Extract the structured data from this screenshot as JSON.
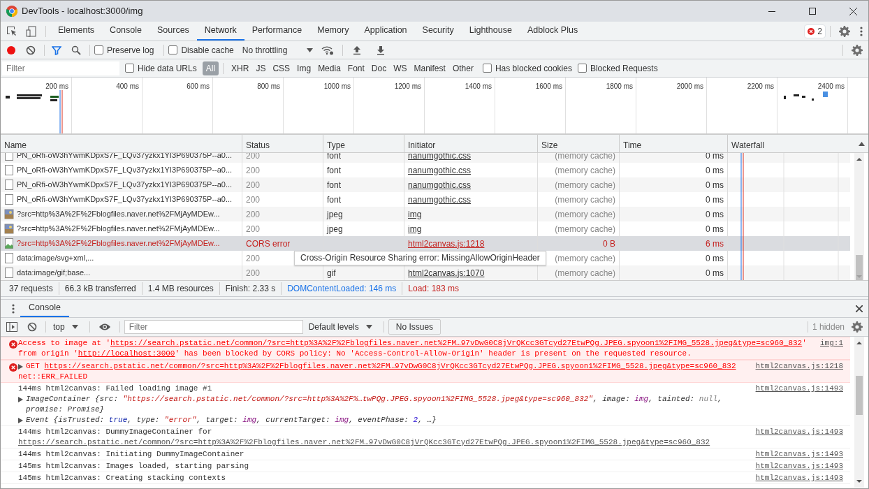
{
  "window": {
    "title": "DevTools - localhost:3000/img"
  },
  "panel_tabs": [
    {
      "label": "Elements",
      "selected": false
    },
    {
      "label": "Console",
      "selected": false
    },
    {
      "label": "Sources",
      "selected": false
    },
    {
      "label": "Network",
      "selected": true
    },
    {
      "label": "Performance",
      "selected": false
    },
    {
      "label": "Memory",
      "selected": false
    },
    {
      "label": "Application",
      "selected": false
    },
    {
      "label": "Security",
      "selected": false
    },
    {
      "label": "Lighthouse",
      "selected": false
    },
    {
      "label": "Adblock Plus",
      "selected": false
    }
  ],
  "error_count": "2",
  "network_toolbar": {
    "recording": true,
    "preserve_log": {
      "label": "Preserve log",
      "checked": false
    },
    "disable_cache": {
      "label": "Disable cache",
      "checked": false
    },
    "throttling": "No throttling"
  },
  "filter_bar": {
    "placeholder": "Filter",
    "hide_data_urls": {
      "label": "Hide data URLs",
      "checked": false
    },
    "types": [
      {
        "label": "All",
        "selected": true
      },
      {
        "label": "XHR",
        "selected": false
      },
      {
        "label": "JS",
        "selected": false
      },
      {
        "label": "CSS",
        "selected": false
      },
      {
        "label": "Img",
        "selected": false
      },
      {
        "label": "Media",
        "selected": false
      },
      {
        "label": "Font",
        "selected": false
      },
      {
        "label": "Doc",
        "selected": false
      },
      {
        "label": "WS",
        "selected": false
      },
      {
        "label": "Manifest",
        "selected": false
      },
      {
        "label": "Other",
        "selected": false
      }
    ],
    "extra_checks": [
      {
        "label": "Has blocked cookies",
        "checked": false
      },
      {
        "label": "Blocked Requests",
        "checked": false
      }
    ]
  },
  "overview": {
    "ticks": [
      "200 ms",
      "400 ms",
      "600 ms",
      "800 ms",
      "1000 ms",
      "1200 ms",
      "1400 ms",
      "1600 ms",
      "1800 ms",
      "2000 ms",
      "2200 ms",
      "2400 ms"
    ]
  },
  "table": {
    "columns": [
      "Name",
      "Status",
      "Type",
      "Initiator",
      "Size",
      "Time",
      "Waterfall"
    ],
    "rows": [
      {
        "kind": "file",
        "name": "PN_oRfi-oW3hYwmKDpxS7F_LQv37yzkx1YI3P690375P--a0...",
        "status": "200",
        "type": "font",
        "initiator": "nanumgothic.css",
        "size": "(memory cache)",
        "time": "0 ms",
        "error": false,
        "selected": false
      },
      {
        "kind": "file",
        "name": "PN_oRfi-oW3hYwmKDpxS7F_LQv37yzkx1YI3P690375P--a0...",
        "status": "200",
        "type": "font",
        "initiator": "nanumgothic.css",
        "size": "(memory cache)",
        "time": "0 ms",
        "error": false,
        "selected": false
      },
      {
        "kind": "file",
        "name": "PN_oRfi-oW3hYwmKDpxS7F_LQv37yzkx1YI3P690375P--a0...",
        "status": "200",
        "type": "font",
        "initiator": "nanumgothic.css",
        "size": "(memory cache)",
        "time": "0 ms",
        "error": false,
        "selected": false
      },
      {
        "kind": "file",
        "name": "PN_oRfi-oW3hYwmKDpxS7F_LQv37yzkx1YI3P690375P--a0...",
        "status": "200",
        "type": "font",
        "initiator": "nanumgothic.css",
        "size": "(memory cache)",
        "time": "0 ms",
        "error": false,
        "selected": false
      },
      {
        "kind": "image",
        "name": "?src=http%3A%2F%2Fblogfiles.naver.net%2FMjAyMDEw...",
        "status": "200",
        "type": "jpeg",
        "initiator": "img",
        "size": "(memory cache)",
        "time": "0 ms",
        "error": false,
        "selected": false
      },
      {
        "kind": "image",
        "name": "?src=http%3A%2F%2Fblogfiles.naver.net%2FMjAyMDEw...",
        "status": "200",
        "type": "jpeg",
        "initiator": "img",
        "size": "(memory cache)",
        "time": "0 ms",
        "error": false,
        "selected": false
      },
      {
        "kind": "broken-image",
        "name": "?src=http%3A%2F%2Fblogfiles.naver.net%2FMjAyMDEw...",
        "status": "CORS error",
        "initiator": "html2canvas.js:1218",
        "size": "0 B",
        "time": "6 ms",
        "error": true,
        "selected": true
      },
      {
        "kind": "file",
        "name": "data:image/svg+xml,...",
        "status": "200",
        "size": "(memory cache)",
        "time": "0 ms",
        "error": false,
        "selected": false
      },
      {
        "kind": "file",
        "name": "data:image/gif;base...",
        "status": "200",
        "type": "gif",
        "initiator": "html2canvas.js:1070",
        "size": "(memory cache)",
        "time": "0 ms",
        "error": false,
        "selected": false
      }
    ]
  },
  "tooltip": "Cross-Origin Resource Sharing error: MissingAllowOriginHeader",
  "summary": [
    {
      "kind": "plain",
      "text": "37 requests"
    },
    {
      "kind": "plain",
      "text": "66.3 kB transferred"
    },
    {
      "kind": "plain",
      "text": "1.4 MB resources"
    },
    {
      "kind": "plain",
      "text": "Finish: 2.33 s"
    },
    {
      "kind": "dom",
      "text": "DOMContentLoaded: 146 ms"
    },
    {
      "kind": "load",
      "text": "Load: 183 ms"
    }
  ],
  "drawer": {
    "tabs": [
      {
        "label": "Console",
        "selected": true
      }
    ],
    "context": "top",
    "filter_placeholder": "Filter",
    "levels": "Default levels",
    "issues": "No Issues",
    "hidden": "1 hidden"
  },
  "messages": [
    {
      "kind": "error",
      "expandable": false,
      "parts": [
        {
          "kind": "plain",
          "text": "Access to image at '"
        },
        {
          "kind": "link",
          "text": "https://search.pstatic.net/common/?src=http%3A%2F%2Fblogfiles.naver.net%2FM…97vDwG0C8jVrQKcc3GTcyd27EtwPQg.JPEG.spyoon1%2FIMG_5528.jpeg&type=sc960_832"
        },
        {
          "kind": "plain",
          "text": "' from origin '"
        },
        {
          "kind": "link",
          "text": "http://localhost:3000"
        },
        {
          "kind": "plain",
          "text": "' has been blocked by CORS policy: No 'Access-Control-Allow-Origin' header is present on the requested resource."
        }
      ],
      "source": "img:1"
    },
    {
      "kind": "error",
      "expandable": true,
      "parts": [
        {
          "kind": "plain",
          "text": "GET "
        },
        {
          "kind": "link",
          "text": "https://search.pstatic.net/common/?src=http%3A%2F%2Fblogfiles.naver.net%2FM…97vDwG0C8jVrQKcc3GTcyd27EtwPQg.JPEG.spyoon1%2FIMG_5528.jpeg&type=sc960_832"
        }
      ],
      "detail": "net::ERR_FAILED",
      "source": "html2canvas.js:1218"
    },
    {
      "kind": "log",
      "expandable": false,
      "parts": [
        {
          "kind": "plain",
          "text": "144ms html2canvas: Failed loading image #1"
        }
      ],
      "source": "html2canvas.js:1493",
      "objects": [
        [
          {
            "kind": "plain",
            "text": "ImageContainer {src: "
          },
          {
            "kind": "string",
            "text": "\"https://search.pstatic.net/common/?src=http%3A%2F%…twPQg.JPEG.spyoon1%2FIMG_5528.jpeg&type=sc960_832\""
          },
          {
            "kind": "plain",
            "text": ", image: "
          },
          {
            "kind": "node",
            "text": "img"
          },
          {
            "kind": "plain",
            "text": ", tainted: "
          },
          {
            "kind": "null",
            "text": "null"
          },
          {
            "kind": "plain",
            "text": ", promise: Promise}"
          }
        ],
        [
          {
            "kind": "plain",
            "text": "Event {isTrusted: "
          },
          {
            "kind": "keyword",
            "text": "true"
          },
          {
            "kind": "plain",
            "text": ", type: "
          },
          {
            "kind": "string",
            "text": "\"error\""
          },
          {
            "kind": "plain",
            "text": ", target: "
          },
          {
            "kind": "node",
            "text": "img"
          },
          {
            "kind": "plain",
            "text": ", currentTarget: "
          },
          {
            "kind": "node",
            "text": "img"
          },
          {
            "kind": "plain",
            "text": ", eventPhase: "
          },
          {
            "kind": "number",
            "text": "2"
          },
          {
            "kind": "plain",
            "text": ", …}"
          }
        ]
      ]
    },
    {
      "kind": "log",
      "expandable": false,
      "parts": [
        {
          "kind": "plain",
          "text": "144ms html2canvas: DummyImageContainer for "
        },
        {
          "kind": "link",
          "text": "https://search.pstatic.net/common/?src=http%3A%2F%2Fblogfiles.naver.net%2FM…97vDwG0C8jVrQKcc3GTcyd27EtwPQg.JPEG.spyoon1%2FIMG_5528.jpeg&type=sc960_832"
        }
      ],
      "source": "html2canvas.js:1493"
    },
    {
      "kind": "log",
      "expandable": false,
      "parts": [
        {
          "kind": "plain",
          "text": "144ms html2canvas: Initiating DummyImageContainer"
        }
      ],
      "source": "html2canvas.js:1493"
    },
    {
      "kind": "log",
      "expandable": false,
      "parts": [
        {
          "kind": "plain",
          "text": "145ms html2canvas: Images loaded, starting parsing"
        }
      ],
      "source": "html2canvas.js:1493"
    },
    {
      "kind": "log",
      "expandable": false,
      "parts": [
        {
          "kind": "plain",
          "text": "145ms html2canvas: Creating stacking contexts"
        }
      ],
      "source": "html2canvas.js:1493"
    }
  ]
}
